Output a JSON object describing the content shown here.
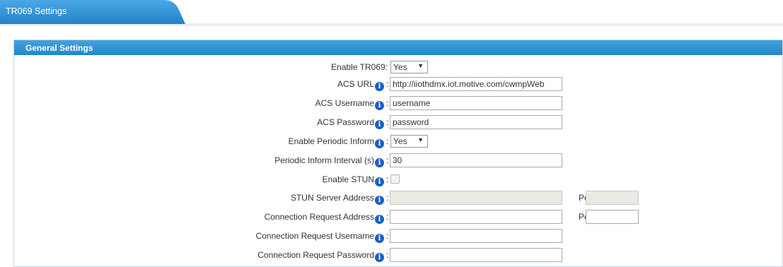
{
  "tab": {
    "label": "TR069 Settings"
  },
  "panel": {
    "title": "General Settings"
  },
  "fields": {
    "enable_tr069": {
      "label": "Enable TR069:",
      "value": "Yes"
    },
    "acs_url": {
      "label": "ACS URL",
      "value": "http://iiothdmx.iot.motive.com/cwmpWeb"
    },
    "acs_username": {
      "label": "ACS Username",
      "value": "username"
    },
    "acs_password": {
      "label": "ACS Password",
      "value": "password"
    },
    "enable_periodic_inform": {
      "label": "Enable Periodic Inform",
      "value": "Yes"
    },
    "periodic_inform_interval": {
      "label": "Periodic Inform Interval (s)",
      "value": "30"
    },
    "enable_stun": {
      "label": "Enable STUN",
      "checked": false
    },
    "stun_server_address": {
      "label": "STUN Server Address",
      "value": "",
      "port_label": "Port:",
      "port_value": ""
    },
    "connection_request_address": {
      "label": "Connection Request Address",
      "value": "",
      "port_label": "Port:",
      "port_value": ""
    },
    "connection_request_username": {
      "label": "Connection Request Username",
      "value": ""
    },
    "connection_request_password": {
      "label": "Connection Request Password",
      "value": ""
    }
  },
  "info_glyph": "i",
  "colon": ":",
  "dropdown_arrow": "▼",
  "colors": {
    "header": "#2f95d6",
    "tab": "#3399dd",
    "info_icon": "#1a5fc4"
  }
}
